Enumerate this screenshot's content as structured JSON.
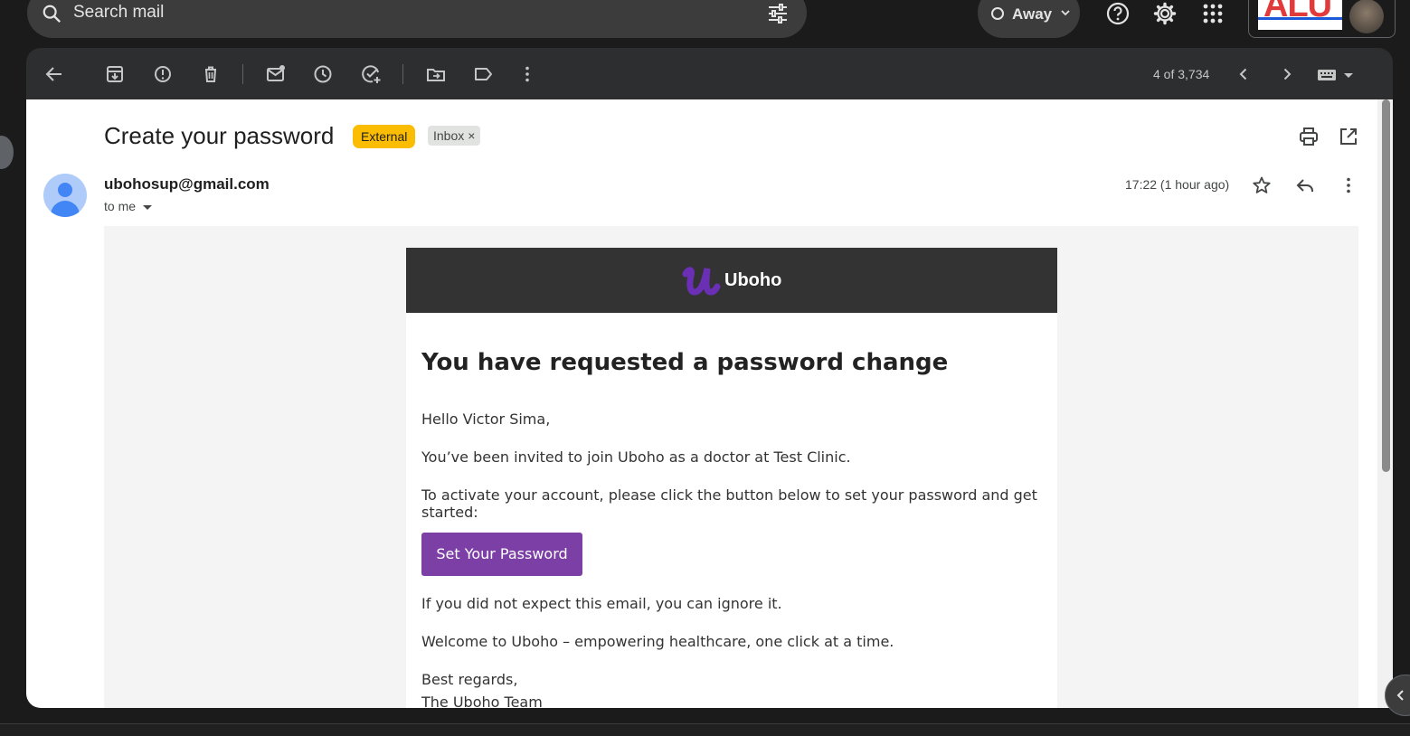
{
  "search": {
    "placeholder": "Search mail"
  },
  "status": {
    "label": "Away"
  },
  "account": {
    "logo_text": "ALU"
  },
  "toolbar": {
    "counter": "4 of 3,734",
    "icons": [
      "back-arrow-icon",
      "archive-icon",
      "report-spam-icon",
      "delete-icon",
      "mark-unread-icon",
      "snooze-icon",
      "add-task-icon",
      "move-to-icon",
      "label-icon",
      "more-vert-icon"
    ]
  },
  "message": {
    "subject": "Create your password",
    "badges": {
      "external": "External",
      "inbox": "Inbox"
    },
    "sender": "ubohosup@gmail.com",
    "recipient": "to me",
    "timestamp": "17:22 (1 hour ago)"
  },
  "email": {
    "brand": "Uboho",
    "brand_color": "#6a2fb5",
    "title": "You have requested a password change",
    "greeting": "Hello Victor Sima,",
    "line1": "You’ve been invited to join Uboho as a doctor at Test Clinic.",
    "line2": "To activate your account, please click the button below to set your password and get started:",
    "cta_label": "Set Your Password",
    "cta_color": "#7b3fa5",
    "line3": "If you did not expect this email, you can ignore it.",
    "line4": "Welcome to Uboho – empowering healthcare, one click at a time.",
    "signoff": "Best regards,",
    "signature": "The Uboho Team"
  },
  "colors": {
    "accent_badge": "#fbbc04",
    "toolbar_bg": "#2d2e30",
    "email_header_bg": "#333333"
  }
}
